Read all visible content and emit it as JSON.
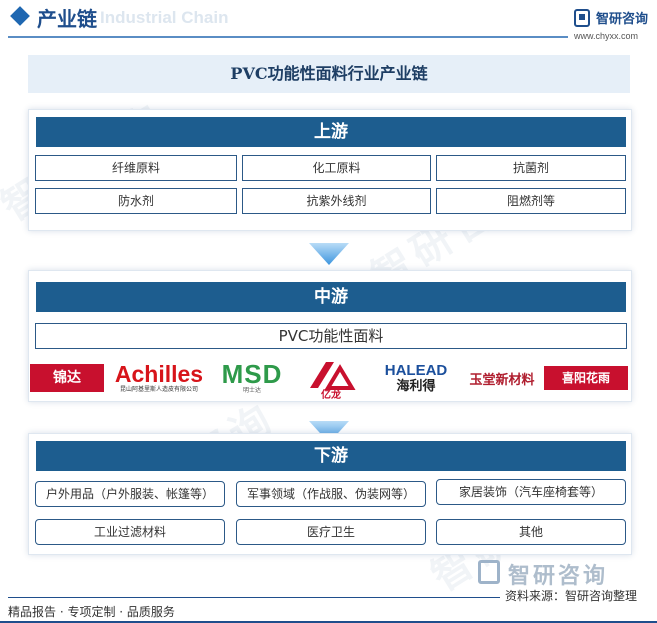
{
  "header": {
    "title": "产业链",
    "ghost_text": "Industrial Chain",
    "logo_name": "智研咨询",
    "logo_url": "www.chyxx.com"
  },
  "main_title": "PVC功能性面料行业产业链",
  "upstream": {
    "label": "上游",
    "items": [
      "纤维原料",
      "化工原料",
      "抗菌剂",
      "防水剂",
      "抗紫外线剂",
      "阻燃剂等"
    ]
  },
  "midstream": {
    "label": "中游",
    "product": "PVC功能性面料",
    "brands": [
      {
        "text": "锦达",
        "sub": "",
        "color": "#c8102e",
        "icon": "jinda-logo"
      },
      {
        "text": "Achilles",
        "sub": "昆山阿基里斯人造皮有限公司",
        "color": "#d7141a",
        "icon": "achilles-logo"
      },
      {
        "text": "MSD",
        "sub": "明士达",
        "color": "#2e9a4a",
        "icon": "msd-logo"
      },
      {
        "text": "亿龙",
        "sub": "",
        "color": "#c8102e",
        "icon": "yilong-logo"
      },
      {
        "text": "HALEAD",
        "sub": "海利得",
        "color": "#1b4f9c",
        "icon": "halead-logo"
      },
      {
        "text": "玉堂新材料",
        "sub": "",
        "color": "#b01e2f",
        "icon": "yutang-logo"
      },
      {
        "text": "喜阳花雨",
        "sub": "",
        "color": "#c8102e",
        "icon": "xiyang-logo"
      }
    ]
  },
  "downstream": {
    "label": "下游",
    "items": [
      "户外用品（户外服装、帐篷等）",
      "军事领域（作战服、伪装网等）",
      "家居装饰（汽车座椅套等）",
      "工业过滤材料",
      "医疗卫生",
      "其他"
    ]
  },
  "footer": {
    "logo_name": "智研咨询",
    "source": "资料来源：智研咨询整理",
    "tagline": "精品报告 · 专项定制 · 品质服务"
  },
  "watermark": "智研咨询",
  "colors": {
    "band": "#1d5d8f",
    "accent": "#1f4e8c",
    "arrow": "#4a9ee0"
  }
}
